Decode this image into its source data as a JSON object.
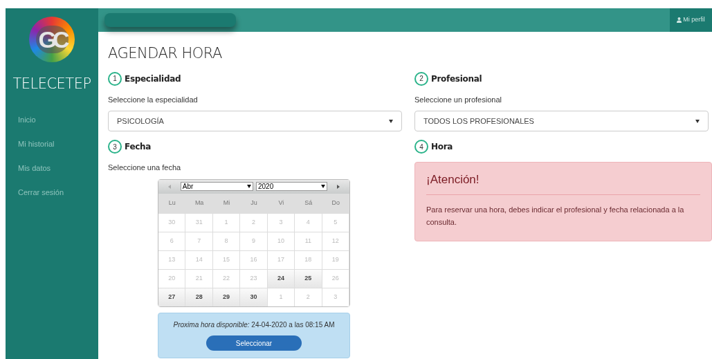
{
  "sidebar": {
    "logo_text": "GC",
    "brand": "TELECETEP",
    "items": [
      {
        "label": "Inicio",
        "selected": false
      },
      {
        "label": "Mi historial",
        "selected": false
      },
      {
        "label": "Mis datos",
        "selected": false
      },
      {
        "label": "Cerrar sesión",
        "selected": false
      }
    ]
  },
  "topbar": {
    "profile": "Mi perfil"
  },
  "title": "AGENDAR HORA",
  "steps": [
    {
      "number": "1",
      "title": "Especialidad",
      "kind": "select",
      "label": "Seleccione la especialidad",
      "value": "PSICOLOGÍA"
    },
    {
      "number": "2",
      "title": "Profesional",
      "kind": "select",
      "label": "Seleccione un profesional",
      "value": "TODOS LOS PROFESIONALES"
    },
    {
      "number": "3",
      "title": "Fecha",
      "kind": "calendar",
      "label": "Seleccione una fecha"
    },
    {
      "number": "4",
      "title": "Hora",
      "kind": "alert"
    }
  ],
  "calendar": {
    "month": "Abr",
    "year": "2020",
    "weekdays": [
      "Lu",
      "Ma",
      "Mi",
      "Ju",
      "Vi",
      "Sá",
      "Do"
    ],
    "weeks": [
      [
        {
          "day": "30",
          "available": false
        },
        {
          "day": "31",
          "available": false
        },
        {
          "day": "1",
          "available": false
        },
        {
          "day": "2",
          "available": false
        },
        {
          "day": "3",
          "available": false
        },
        {
          "day": "4",
          "available": false
        },
        {
          "day": "5",
          "available": false
        }
      ],
      [
        {
          "day": "6",
          "available": false
        },
        {
          "day": "7",
          "available": false
        },
        {
          "day": "8",
          "available": false
        },
        {
          "day": "9",
          "available": false
        },
        {
          "day": "10",
          "available": false
        },
        {
          "day": "11",
          "available": false
        },
        {
          "day": "12",
          "available": false
        }
      ],
      [
        {
          "day": "13",
          "available": false
        },
        {
          "day": "14",
          "available": false
        },
        {
          "day": "15",
          "available": false
        },
        {
          "day": "16",
          "available": false
        },
        {
          "day": "17",
          "available": false
        },
        {
          "day": "18",
          "available": false
        },
        {
          "day": "19",
          "available": false
        }
      ],
      [
        {
          "day": "20",
          "available": false
        },
        {
          "day": "21",
          "available": false
        },
        {
          "day": "22",
          "available": false
        },
        {
          "day": "23",
          "available": false
        },
        {
          "day": "24",
          "available": true
        },
        {
          "day": "25",
          "available": true
        },
        {
          "day": "26",
          "available": false
        }
      ],
      [
        {
          "day": "27",
          "available": true
        },
        {
          "day": "28",
          "available": true
        },
        {
          "day": "29",
          "available": true
        },
        {
          "day": "30",
          "available": true
        },
        {
          "day": "1",
          "available": false
        },
        {
          "day": "2",
          "available": false
        },
        {
          "day": "3",
          "available": false
        }
      ]
    ]
  },
  "next_slot": {
    "text": "*Proxima hora disponible:* 24-04-2020 a las 08:15 AM",
    "button": "Seleccionar"
  },
  "alert": {
    "title": "¡Atención!",
    "message": "Para reservar una hora, debes indicar el profesional y fecha relacionada a la consulta."
  }
}
